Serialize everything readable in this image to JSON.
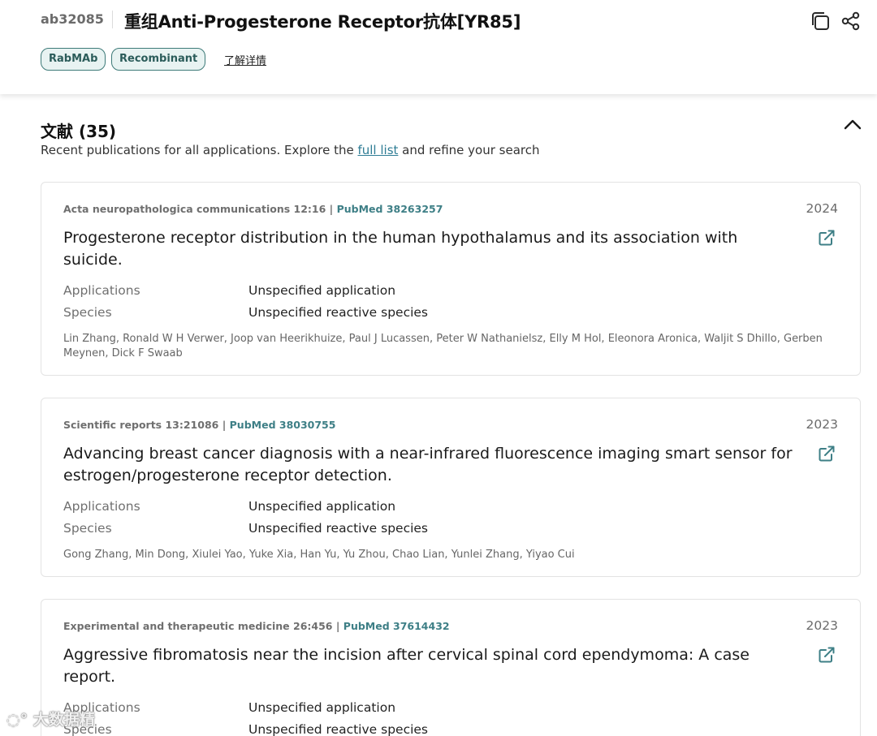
{
  "header": {
    "sku": "ab32085",
    "title": "重组Anti-Progesterone Receptor抗体[YR85]",
    "tags": [
      "RabMAb",
      "Recombinant"
    ],
    "learn_more": "了解详情"
  },
  "section": {
    "title": "文献 (35)",
    "subtitle_before": "Recent publications for all applications. Explore the ",
    "subtitle_link": "full list",
    "subtitle_after": " and refine your search"
  },
  "labels": {
    "applications": "Applications",
    "species": "Species"
  },
  "publications": [
    {
      "journal": "Acta neuropathologica communications 12:16",
      "pubmed": "PubMed 38263257",
      "year": "2024",
      "title": "Progesterone receptor distribution in the human hypothalamus and its association with suicide.",
      "applications": "Unspecified application",
      "species": "Unspecified reactive species",
      "authors": "Lin Zhang, Ronald W H Verwer, Joop van Heerikhuize, Paul J Lucassen, Peter W Nathanielsz, Elly M Hol, Eleonora Aronica, Waljit S Dhillo, Gerben Meynen, Dick F Swaab"
    },
    {
      "journal": "Scientific reports 13:21086",
      "pubmed": "PubMed 38030755",
      "year": "2023",
      "title": "Advancing breast cancer diagnosis with a near-infrared fluorescence imaging smart sensor for estrogen/progesterone receptor detection.",
      "applications": "Unspecified application",
      "species": "Unspecified reactive species",
      "authors": "Gong Zhang, Min Dong, Xiulei Yao, Yuke Xia, Han Yu, Yu Zhou, Chao Lian, Yunlei Zhang, Yiyao Cui"
    },
    {
      "journal": "Experimental and therapeutic medicine 26:456",
      "pubmed": "PubMed 37614432",
      "year": "2023",
      "title": "Aggressive fibromatosis near the incision after cervical spinal cord ependymoma: A case report.",
      "applications": "Unspecified application",
      "species": "Unspecified reactive species",
      "authors": ""
    }
  ],
  "watermark": "大数据精"
}
